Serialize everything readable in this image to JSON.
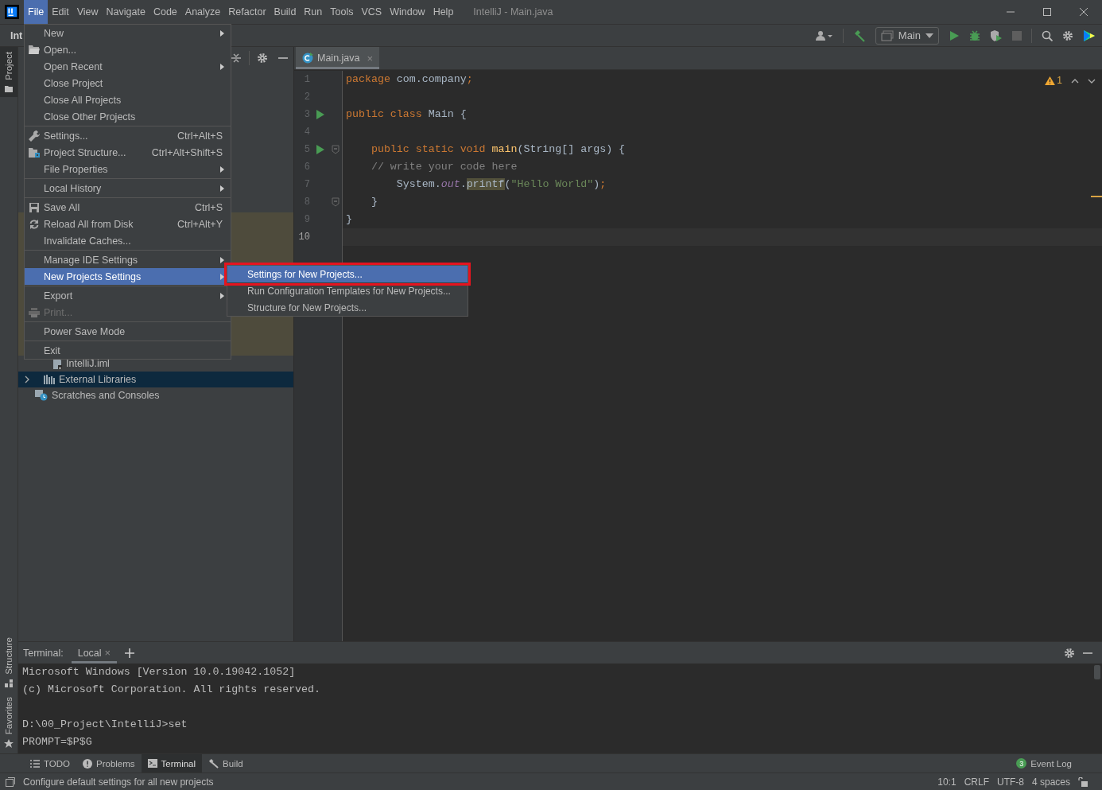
{
  "title_bar": {
    "menus": [
      {
        "label": "File",
        "selected": true
      },
      {
        "label": "Edit",
        "selected": false
      },
      {
        "label": "View",
        "selected": false
      },
      {
        "label": "Navigate",
        "selected": false
      },
      {
        "label": "Code",
        "selected": false
      },
      {
        "label": "Analyze",
        "selected": false
      },
      {
        "label": "Refactor",
        "selected": false
      },
      {
        "label": "Build",
        "selected": false
      },
      {
        "label": "Run",
        "selected": false
      },
      {
        "label": "Tools",
        "selected": false
      },
      {
        "label": "VCS",
        "selected": false
      },
      {
        "label": "Window",
        "selected": false
      },
      {
        "label": "Help",
        "selected": false
      }
    ],
    "title": "IntelliJ - Main.java"
  },
  "nav_bar": {
    "project": "Int",
    "run_config": "Main"
  },
  "side_stripe": {
    "top": [
      {
        "label": "Project",
        "selected": true
      }
    ],
    "bottom": [
      {
        "label": "Structure",
        "kind": "structure"
      },
      {
        "label": "Favorites",
        "kind": "star"
      }
    ]
  },
  "project_tree": {
    "items": [
      {
        "label": "IntelliJ.iml",
        "kind": "file",
        "selected": false
      },
      {
        "label": "External Libraries",
        "kind": "library",
        "selected": true,
        "expanded": false
      },
      {
        "label": "Scratches and Consoles",
        "kind": "scratch",
        "selected": false
      }
    ]
  },
  "file_menu": {
    "groups": [
      [
        {
          "label": "New",
          "submenu": true,
          "disabled": false,
          "selected": false
        },
        {
          "label": "Open...",
          "kind": "folder",
          "submenu": false,
          "disabled": false,
          "selected": false
        },
        {
          "label": "Open Recent",
          "submenu": true,
          "disabled": false,
          "selected": false
        },
        {
          "label": "Close Project",
          "submenu": false,
          "disabled": false,
          "selected": false
        },
        {
          "label": "Close All Projects",
          "submenu": false,
          "disabled": false,
          "selected": false
        },
        {
          "label": "Close Other Projects",
          "submenu": false,
          "disabled": false,
          "selected": false
        }
      ],
      [
        {
          "label": "Settings...",
          "kind": "wrench",
          "shortcut": "Ctrl+Alt+S",
          "submenu": false,
          "disabled": false,
          "selected": false
        },
        {
          "label": "Project Structure...",
          "kind": "structure",
          "shortcut": "Ctrl+Alt+Shift+S",
          "submenu": false,
          "disabled": false,
          "selected": false
        },
        {
          "label": "File Properties",
          "submenu": true,
          "disabled": false,
          "selected": false
        }
      ],
      [
        {
          "label": "Local History",
          "submenu": true,
          "disabled": false,
          "selected": false
        }
      ],
      [
        {
          "label": "Save All",
          "kind": "save",
          "shortcut": "Ctrl+S",
          "submenu": false,
          "disabled": false,
          "selected": false
        },
        {
          "label": "Reload All from Disk",
          "kind": "reload",
          "shortcut": "Ctrl+Alt+Y",
          "submenu": false,
          "disabled": false,
          "selected": false
        },
        {
          "label": "Invalidate Caches...",
          "submenu": false,
          "disabled": false,
          "selected": false
        }
      ],
      [
        {
          "label": "Manage IDE Settings",
          "submenu": true,
          "disabled": false,
          "selected": false
        },
        {
          "label": "New Projects Settings",
          "submenu": true,
          "disabled": false,
          "selected": true
        }
      ],
      [
        {
          "label": "Export",
          "submenu": true,
          "disabled": false,
          "selected": false
        },
        {
          "label": "Print...",
          "kind": "printer",
          "submenu": false,
          "disabled": true,
          "selected": false
        }
      ],
      [
        {
          "label": "Power Save Mode",
          "submenu": false,
          "disabled": false,
          "selected": false
        }
      ],
      [
        {
          "label": "Exit",
          "submenu": false,
          "disabled": false,
          "selected": false
        }
      ]
    ]
  },
  "submenu": {
    "items": [
      {
        "label": "Settings for New Projects...",
        "selected": true,
        "highlighted": true
      },
      {
        "label": "Run Configuration Templates for New Projects...",
        "selected": false,
        "highlighted": false
      },
      {
        "label": "Structure for New Projects...",
        "selected": false,
        "highlighted": false
      }
    ]
  },
  "editor": {
    "tabs": [
      {
        "label": "Main.java",
        "close": "×",
        "selected": true
      }
    ],
    "warnings": "1",
    "lines": [
      {
        "number": "1",
        "run": false,
        "fold": false,
        "current": false,
        "tokens": [
          {
            "kind": "keyword",
            "text": "package "
          },
          {
            "kind": "plain",
            "text": "com.company"
          },
          {
            "kind": "keyword",
            "text": ";"
          }
        ]
      },
      {
        "number": "2",
        "run": false,
        "fold": false,
        "current": false
      },
      {
        "number": "3",
        "run": true,
        "fold": false,
        "current": false,
        "tokens": [
          {
            "kind": "keyword",
            "text": "public class "
          },
          {
            "kind": "plain",
            "text": "Main {"
          }
        ]
      },
      {
        "number": "4",
        "run": false,
        "fold": false,
        "current": false
      },
      {
        "number": "5",
        "run": true,
        "fold": true,
        "current": false,
        "tokens": [
          {
            "kind": "keyword",
            "text": "    public static void "
          },
          {
            "kind": "method",
            "text": "main"
          },
          {
            "kind": "plain",
            "text": "(String[] args) {"
          }
        ]
      },
      {
        "number": "6",
        "run": false,
        "fold": false,
        "current": false,
        "tokens": [
          {
            "kind": "comment",
            "text": "    // write your code here"
          }
        ]
      },
      {
        "number": "7",
        "run": false,
        "fold": false,
        "current": false,
        "tokens": [
          {
            "kind": "plain",
            "text": "        System."
          },
          {
            "kind": "field",
            "text": "out"
          },
          {
            "kind": "plain",
            "text": "."
          },
          {
            "kind": "usage",
            "text": "printf"
          },
          {
            "kind": "plain",
            "text": "("
          },
          {
            "kind": "string",
            "text": "\"Hello World\""
          },
          {
            "kind": "plain",
            "text": ")"
          },
          {
            "kind": "keyword",
            "text": ";"
          }
        ]
      },
      {
        "number": "8",
        "run": false,
        "fold": true,
        "current": false,
        "tokens": [
          {
            "kind": "plain",
            "text": "    }"
          }
        ]
      },
      {
        "number": "9",
        "run": false,
        "fold": false,
        "current": false,
        "tokens": [
          {
            "kind": "plain",
            "text": "}"
          }
        ]
      },
      {
        "number": "10",
        "run": false,
        "fold": false,
        "current": true
      }
    ]
  },
  "terminal": {
    "label": "Terminal:",
    "tabs": [
      {
        "label": "Local",
        "close": "×",
        "selected": true
      }
    ],
    "blocks": [
      [
        "Microsoft Windows [Version 10.0.19042.1052]",
        "(c) Microsoft Corporation. All rights reserved."
      ],
      [
        "D:\\00_Project\\IntelliJ>set",
        "PROMPT=$P$G"
      ]
    ]
  },
  "tool_tabs": [
    {
      "label": "TODO",
      "kind": "list",
      "selected": false
    },
    {
      "label": "Problems",
      "kind": "info",
      "selected": false
    },
    {
      "label": "Terminal",
      "kind": "terminal",
      "selected": true
    },
    {
      "label": "Build",
      "kind": "hammer",
      "selected": false
    }
  ],
  "event_log": {
    "count": "3",
    "label": "Event Log"
  },
  "status_bar": {
    "message": "Configure default settings for all new projects",
    "items": [
      "10:1",
      "CRLF",
      "UTF-8",
      "4 spaces"
    ]
  }
}
